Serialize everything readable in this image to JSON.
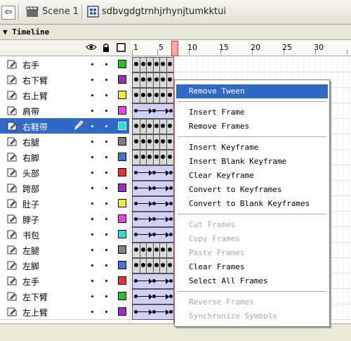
{
  "topbar": {
    "scene_label": "Scene 1",
    "symbol_label": "sdbvgdgtrnhjrhynjtumkktui",
    "back_icon": "back-arrow-icon",
    "scene_icon": "clapper-icon",
    "symbol_icon": "movieclip-icon"
  },
  "timeline": {
    "title": "Timeline",
    "collapse_icon": "triangle-down-icon",
    "header_icons": [
      "eye-icon",
      "lock-icon",
      "outline-icon"
    ]
  },
  "ruler": {
    "labels": [
      "1",
      "5",
      "10",
      "15",
      "20",
      "25",
      "30"
    ]
  },
  "layers": [
    {
      "name": "右手",
      "color": "#22c422",
      "frames": "keyframes"
    },
    {
      "name": "右下臂",
      "color": "#9a2fc8",
      "frames": "keyframes"
    },
    {
      "name": "右上臂",
      "color": "#f4f020",
      "frames": "keyframes"
    },
    {
      "name": "肩带",
      "color": "#ee40ee",
      "frames": "tween"
    },
    {
      "name": "右鞋带",
      "color": "#20e0e0",
      "frames": "keyframes",
      "selected": true
    },
    {
      "name": "右腿",
      "color": "#808080",
      "frames": "keyframes"
    },
    {
      "name": "右脚",
      "color": "#3a78e0",
      "frames": "keyframes"
    },
    {
      "name": "头部",
      "color": "#ee3030",
      "frames": "tween"
    },
    {
      "name": "跨部",
      "color": "#9a2fc8",
      "frames": "tween"
    },
    {
      "name": "肚子",
      "color": "#f4f020",
      "frames": "tween"
    },
    {
      "name": "脖子",
      "color": "#ee40ee",
      "frames": "tween"
    },
    {
      "name": "书包",
      "color": "#20e0e0",
      "frames": "tween"
    },
    {
      "name": "左腿",
      "color": "#808080",
      "frames": "keyframes"
    },
    {
      "name": "左脚",
      "color": "#3a78e0",
      "frames": "keyframes"
    },
    {
      "name": "左手",
      "color": "#ee3030",
      "frames": "tween"
    },
    {
      "name": "左下臂",
      "color": "#22c422",
      "frames": "tween"
    },
    {
      "name": "左上臂",
      "color": "#9a2fc8",
      "frames": "tween"
    }
  ],
  "context_menu": {
    "items": [
      {
        "label": "Remove Tween",
        "state": "highlighted"
      },
      {
        "label": "Insert Frame",
        "state": "enabled"
      },
      {
        "label": "Remove Frames",
        "state": "enabled"
      },
      {
        "label": "Insert Keyframe",
        "state": "enabled"
      },
      {
        "label": "Insert Blank Keyframe",
        "state": "enabled"
      },
      {
        "label": "Clear Keyframe",
        "state": "enabled"
      },
      {
        "label": "Convert to Keyframes",
        "state": "enabled"
      },
      {
        "label": "Convert to Blank Keyframes",
        "state": "enabled"
      },
      {
        "label": "Cut Frames",
        "state": "disabled"
      },
      {
        "label": "Copy Frames",
        "state": "disabled"
      },
      {
        "label": "Paste Frames",
        "state": "disabled"
      },
      {
        "label": "Clear Frames",
        "state": "enabled"
      },
      {
        "label": "Select All Frames",
        "state": "enabled"
      },
      {
        "label": "Reverse Frames",
        "state": "disabled"
      },
      {
        "label": "Synchronize Symbols",
        "state": "disabled"
      }
    ]
  }
}
